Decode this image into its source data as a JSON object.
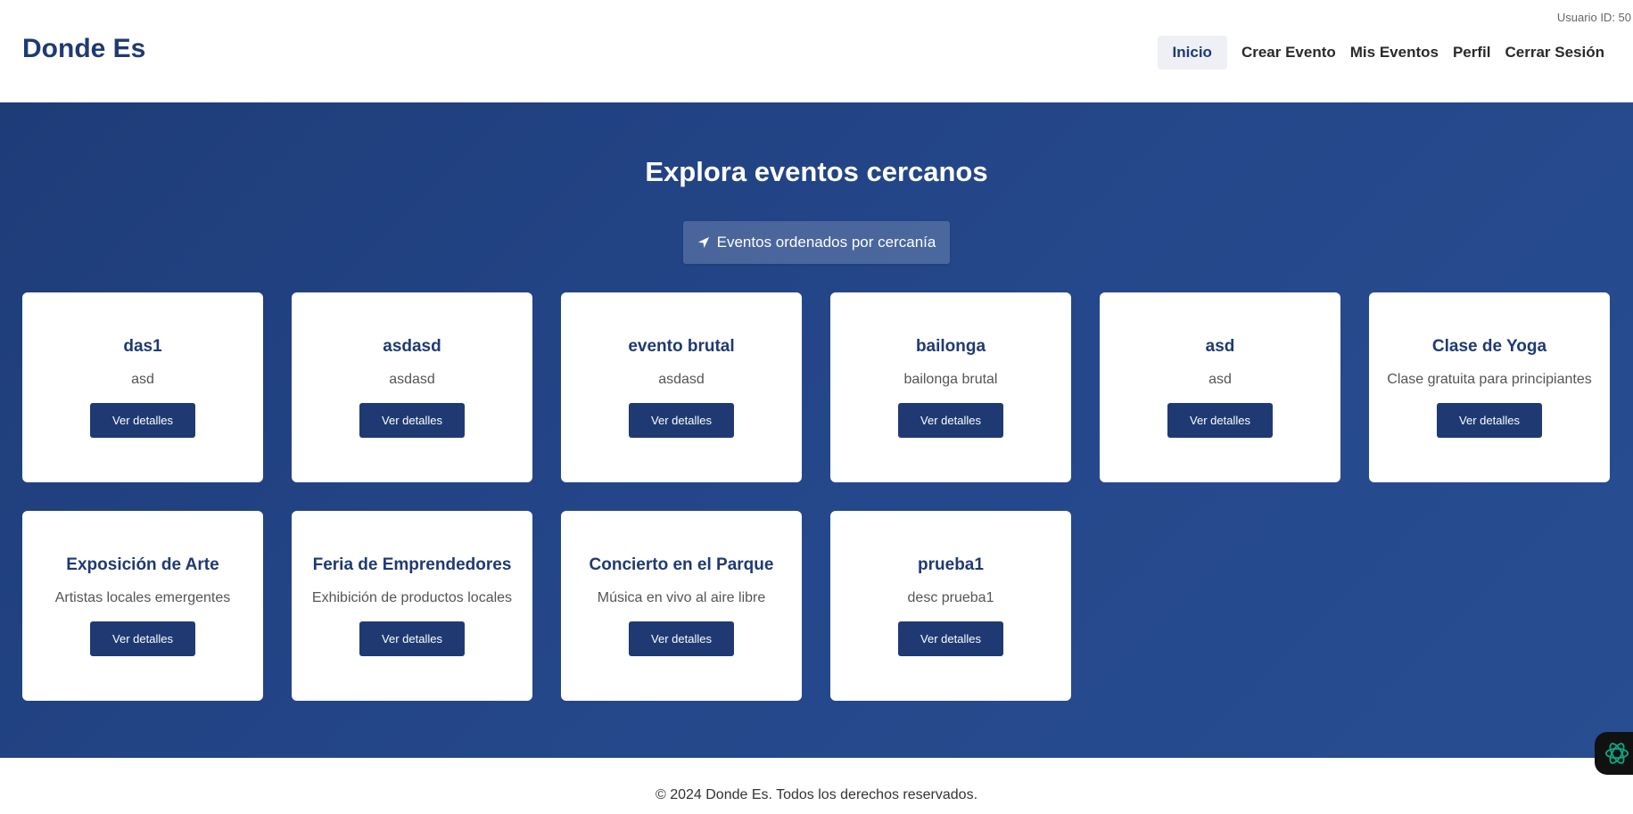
{
  "header": {
    "user_id": "Usuario ID: 50",
    "brand": "Donde Es",
    "nav": [
      "Inicio",
      "Crear Evento",
      "Mis Eventos",
      "Perfil",
      "Cerrar Sesión"
    ],
    "active_nav": "Inicio"
  },
  "hero": {
    "title": "Explora eventos cercanos",
    "sort_button": {
      "icon": "location-arrow-icon",
      "label": "Eventos ordenados por cercanía"
    }
  },
  "events": [
    {
      "title": "das1",
      "description": "asd",
      "button": "Ver detalles"
    },
    {
      "title": "asdasd",
      "description": "asdasd",
      "button": "Ver detalles"
    },
    {
      "title": "evento brutal",
      "description": "asdasd",
      "button": "Ver detalles"
    },
    {
      "title": "bailonga",
      "description": "bailonga brutal",
      "button": "Ver detalles"
    },
    {
      "title": "asd",
      "description": "asd",
      "button": "Ver detalles"
    },
    {
      "title": "Clase de Yoga",
      "description": "Clase gratuita para principiantes",
      "button": "Ver detalles"
    },
    {
      "title": "Exposición de Arte",
      "description": "Artistas locales emergentes",
      "button": "Ver detalles"
    },
    {
      "title": "Feria de Emprendedores",
      "description": "Exhibición de productos locales",
      "button": "Ver detalles"
    },
    {
      "title": "Concierto en el Parque",
      "description": "Música en vivo al aire libre",
      "button": "Ver detalles"
    },
    {
      "title": "prueba1",
      "description": "desc prueba1",
      "button": "Ver detalles"
    }
  ],
  "footer": {
    "text": "© 2024 Donde Es. Todos los derechos reservados."
  },
  "floating_button": {
    "icon": "assistant-icon"
  },
  "colors": {
    "brand": "#1f3a73",
    "hero_background": "#24478a",
    "button": "#1f3a73",
    "assistant_icon": "#10a37f"
  }
}
